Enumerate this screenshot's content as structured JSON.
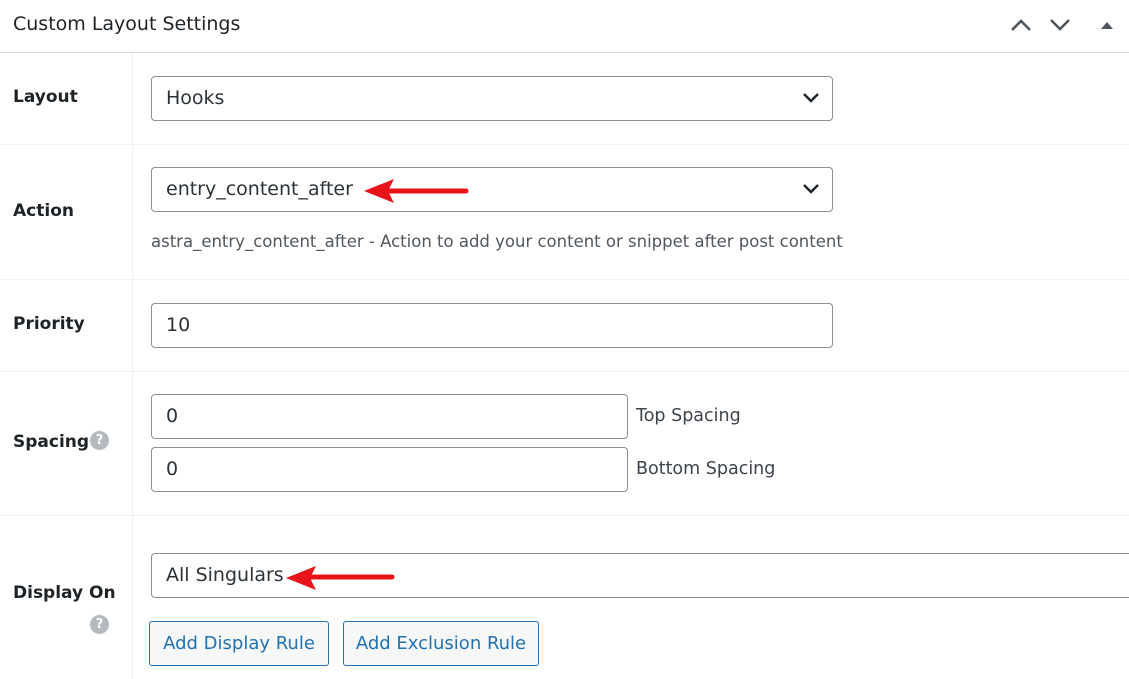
{
  "header": {
    "title": "Custom Layout Settings"
  },
  "rows": {
    "layout": {
      "label": "Layout",
      "value": "Hooks"
    },
    "action": {
      "label": "Action",
      "value": "entry_content_after",
      "description": "astra_entry_content_after - Action to add your content or snippet after post content"
    },
    "priority": {
      "label": "Priority",
      "value": "10"
    },
    "spacing": {
      "label": "Spacing",
      "top_value": "0",
      "top_label": "Top Spacing",
      "bottom_value": "0",
      "bottom_label": "Bottom Spacing"
    },
    "display_on": {
      "label": "Display On",
      "value": "All Singulars",
      "add_display_rule": "Add Display Rule",
      "add_exclusion_rule": "Add Exclusion Rule"
    }
  },
  "help_glyph": "?",
  "colors": {
    "annotation_arrow": "#e8141a",
    "button_accent": "#2271b1"
  }
}
